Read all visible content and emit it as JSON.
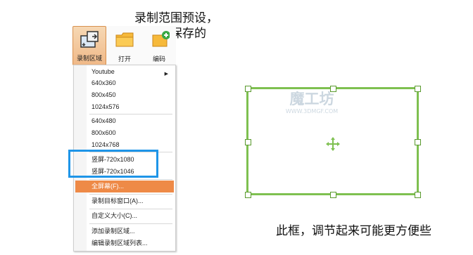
{
  "callouts": {
    "top_line1": "录制范围预设，",
    "top_line2": "可编辑保存的",
    "bottom": "此框，调节起来可能更方便些"
  },
  "toolbar": {
    "record_region_label": "录制区域",
    "open_label": "打开",
    "edit_label": "编码"
  },
  "menu": {
    "items": [
      {
        "label": "Youtube",
        "submenu": true
      },
      {
        "label": "640x360"
      },
      {
        "label": "800x450"
      },
      {
        "label": "1024x576"
      },
      {
        "label": "640x480"
      },
      {
        "label": "800x600"
      },
      {
        "label": "1024x768"
      },
      {
        "label": "竖屏-720x1080"
      },
      {
        "label": "竖屏-720x1046"
      },
      {
        "label": "全屏幕(F)...",
        "highlighted": true
      },
      {
        "label": "录制目标窗口(A)..."
      },
      {
        "label": "自定义大小(C)..."
      },
      {
        "label": "添加录制区域..."
      },
      {
        "label": "编辑录制区域列表..."
      }
    ]
  },
  "watermark": {
    "line1": "魔工坊",
    "line2": "WWW.3DMGF.COM"
  },
  "colors": {
    "highlight": "#ee8a47",
    "callout_box": "#1e95e8",
    "frame": "#7ec050"
  },
  "icons": [
    "record-region-icon",
    "folder-open-icon",
    "edit-icon",
    "move-cross-icon",
    "submenu-arrow-icon"
  ]
}
